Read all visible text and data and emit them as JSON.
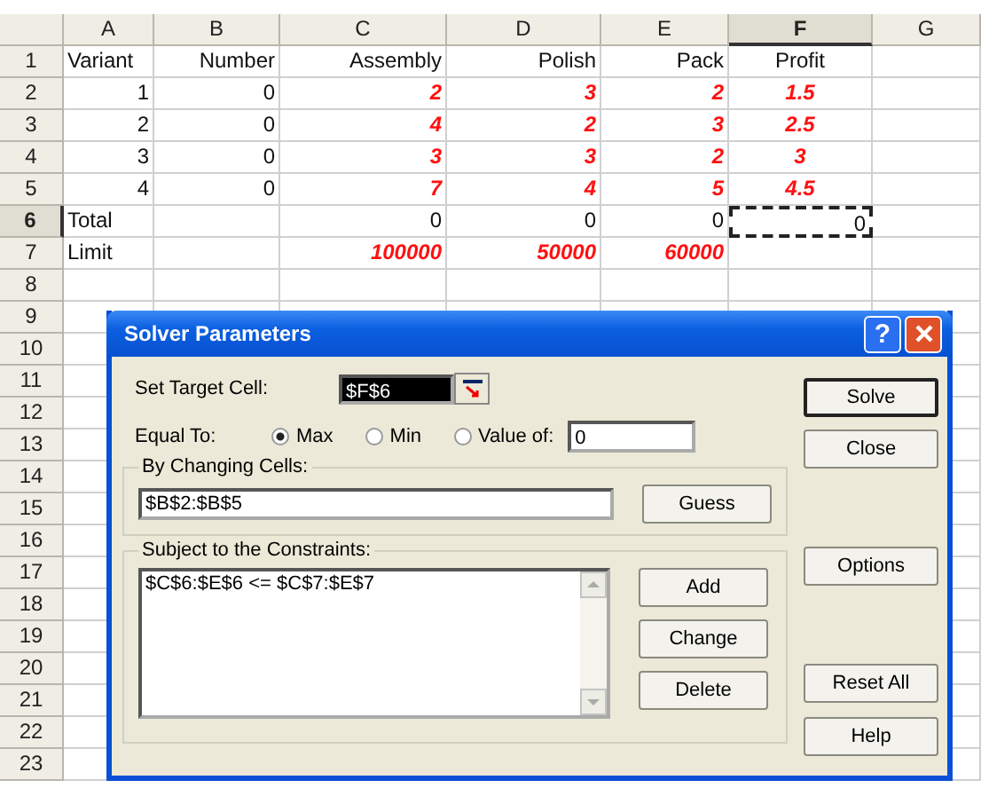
{
  "sheet": {
    "columns": [
      {
        "label": "A",
        "selected": false
      },
      {
        "label": "B",
        "selected": false
      },
      {
        "label": "C",
        "selected": false
      },
      {
        "label": "D",
        "selected": false
      },
      {
        "label": "E",
        "selected": false
      },
      {
        "label": "F",
        "selected": true
      },
      {
        "label": "G",
        "selected": false
      }
    ],
    "rows": [
      {
        "label": "1",
        "selected": false,
        "cells": [
          {
            "text": "Variant",
            "kind": "label",
            "selected": false
          },
          {
            "text": "Number",
            "kind": "header",
            "selected": false
          },
          {
            "text": "Assembly",
            "kind": "header",
            "selected": false
          },
          {
            "text": "Polish",
            "kind": "header",
            "selected": false
          },
          {
            "text": "Pack",
            "kind": "header",
            "selected": false
          },
          {
            "text": "Profit",
            "kind": "header-center",
            "selected": false
          },
          null
        ]
      },
      {
        "label": "2",
        "selected": false,
        "cells": [
          {
            "text": "1",
            "kind": "number",
            "selected": false
          },
          {
            "text": "0",
            "kind": "number",
            "selected": false
          },
          {
            "text": "2",
            "kind": "input",
            "selected": false
          },
          {
            "text": "3",
            "kind": "input",
            "selected": false
          },
          {
            "text": "2",
            "kind": "input",
            "selected": false
          },
          {
            "text": "1.5",
            "kind": "input-center",
            "selected": false
          },
          null
        ]
      },
      {
        "label": "3",
        "selected": false,
        "cells": [
          {
            "text": "2",
            "kind": "number",
            "selected": false
          },
          {
            "text": "0",
            "kind": "number",
            "selected": false
          },
          {
            "text": "4",
            "kind": "input",
            "selected": false
          },
          {
            "text": "2",
            "kind": "input",
            "selected": false
          },
          {
            "text": "3",
            "kind": "input",
            "selected": false
          },
          {
            "text": "2.5",
            "kind": "input-center",
            "selected": false
          },
          null
        ]
      },
      {
        "label": "4",
        "selected": false,
        "cells": [
          {
            "text": "3",
            "kind": "number",
            "selected": false
          },
          {
            "text": "0",
            "kind": "number",
            "selected": false
          },
          {
            "text": "3",
            "kind": "input",
            "selected": false
          },
          {
            "text": "3",
            "kind": "input",
            "selected": false
          },
          {
            "text": "2",
            "kind": "input",
            "selected": false
          },
          {
            "text": "3",
            "kind": "input-center",
            "selected": false
          },
          null
        ]
      },
      {
        "label": "5",
        "selected": false,
        "cells": [
          {
            "text": "4",
            "kind": "number",
            "selected": false
          },
          {
            "text": "0",
            "kind": "number",
            "selected": false
          },
          {
            "text": "7",
            "kind": "input",
            "selected": false
          },
          {
            "text": "4",
            "kind": "input",
            "selected": false
          },
          {
            "text": "5",
            "kind": "input",
            "selected": false
          },
          {
            "text": "4.5",
            "kind": "input-center",
            "selected": false
          },
          null
        ]
      },
      {
        "label": "6",
        "selected": true,
        "cells": [
          {
            "text": "Total",
            "kind": "label",
            "selected": false
          },
          null,
          {
            "text": "0",
            "kind": "number",
            "selected": false
          },
          {
            "text": "0",
            "kind": "number",
            "selected": false
          },
          {
            "text": "0",
            "kind": "number",
            "selected": false
          },
          {
            "text": "0",
            "kind": "number",
            "selected": true
          },
          null
        ]
      },
      {
        "label": "7",
        "selected": false,
        "cells": [
          {
            "text": "Limit",
            "kind": "label",
            "selected": false
          },
          null,
          {
            "text": "100000",
            "kind": "input",
            "selected": false
          },
          {
            "text": "50000",
            "kind": "input",
            "selected": false
          },
          {
            "text": "60000",
            "kind": "input",
            "selected": false
          },
          null,
          null
        ]
      },
      {
        "label": "8",
        "selected": false
      },
      {
        "label": "9",
        "selected": false
      },
      {
        "label": "10",
        "selected": false
      },
      {
        "label": "11",
        "selected": false
      },
      {
        "label": "12",
        "selected": false
      },
      {
        "label": "13",
        "selected": false
      },
      {
        "label": "14",
        "selected": false
      },
      {
        "label": "15",
        "selected": false
      },
      {
        "label": "16",
        "selected": false
      },
      {
        "label": "17",
        "selected": false
      },
      {
        "label": "18",
        "selected": false
      },
      {
        "label": "19",
        "selected": false
      },
      {
        "label": "20",
        "selected": false
      },
      {
        "label": "21",
        "selected": false
      },
      {
        "label": "22",
        "selected": false
      },
      {
        "label": "23",
        "selected": false
      }
    ]
  },
  "dialog": {
    "title": "Solver Parameters",
    "help_button": "?",
    "target": {
      "label": "Set Target Cell:",
      "value": "$F$6",
      "highlighted": true
    },
    "equal_to": {
      "label": "Equal To:",
      "options": [
        {
          "label": "Max",
          "selected": true
        },
        {
          "label": "Min",
          "selected": false
        },
        {
          "label": "Value of:",
          "selected": false
        }
      ],
      "value": "0"
    },
    "changing": {
      "legend": "By Changing Cells:",
      "value": "$B$2:$B$5",
      "button": "Guess"
    },
    "constraints": {
      "legend": "Subject to the Constraints:",
      "items": [
        {
          "text": "$C$6:$E$6 <= $C$7:$E$7",
          "selected": false
        }
      ],
      "buttons": [
        "Add",
        "Change",
        "Delete"
      ]
    },
    "side_buttons": [
      {
        "label": "Solve",
        "default": true
      },
      {
        "label": "Close",
        "default": false
      },
      {
        "label": "Options",
        "default": false
      },
      {
        "label": "Reset All",
        "default": false
      },
      {
        "label": "Help",
        "default": false
      }
    ]
  }
}
